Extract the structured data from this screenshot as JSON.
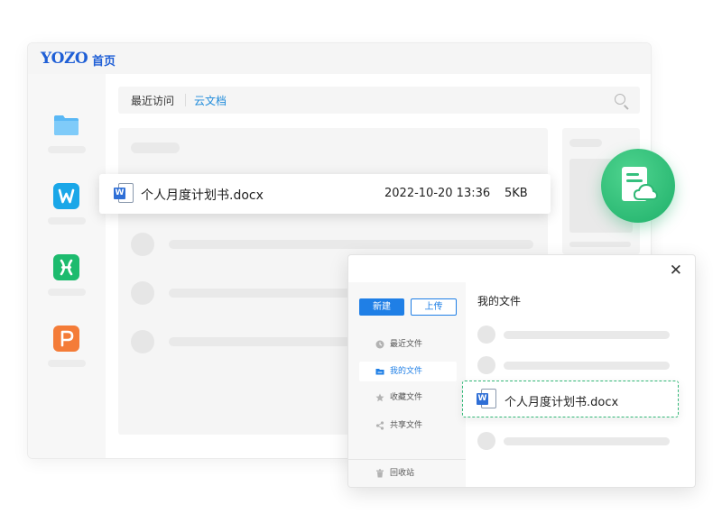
{
  "main_window": {
    "logo": "YOZO",
    "home_title": "首页",
    "tabs": [
      {
        "label": "最近访问"
      },
      {
        "label": "云文档"
      }
    ],
    "apps": [
      {
        "name": "folder",
        "color": "#5ab8f5"
      },
      {
        "name": "wps-writer",
        "letter": "W",
        "color": "#1aa7e8"
      },
      {
        "name": "wps-sheet",
        "letter": "X",
        "color": "#1dbb6e"
      },
      {
        "name": "wps-presentation",
        "letter": "P",
        "color": "#f47c38"
      }
    ]
  },
  "file_card": {
    "icon_letter": "W",
    "name": "个人月度计划书.docx",
    "date": "2022-10-20 13:36",
    "size": "5KB"
  },
  "dialog": {
    "close_glyph": "✕",
    "new_button": "新建",
    "upload_button": "上传",
    "nav": [
      {
        "label": "最近文件",
        "icon": "clock-icon"
      },
      {
        "label": "我的文件",
        "icon": "folder-icon",
        "active": true
      },
      {
        "label": "收藏文件",
        "icon": "star-icon"
      },
      {
        "label": "共享文件",
        "icon": "share-icon"
      }
    ],
    "trash": {
      "label": "回收站",
      "icon": "trash-icon"
    },
    "title": "我的文件",
    "selected_file": {
      "icon_letter": "W",
      "name": "个人月度计划书.docx"
    }
  },
  "colors": {
    "brand_blue": "#1f5fd6",
    "accent_blue": "#1f7fe6",
    "cloud_green": "#1fb06a"
  }
}
